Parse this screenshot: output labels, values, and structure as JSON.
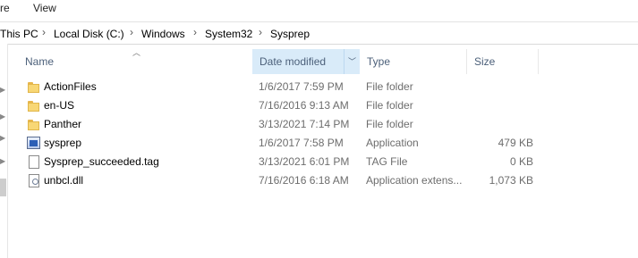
{
  "ribbon": {
    "left_fragment": "re",
    "view_label": "View"
  },
  "breadcrumb": [
    "This PC",
    "Local Disk (C:)",
    "Windows",
    "System32",
    "Sysprep"
  ],
  "columns": {
    "name": "Name",
    "date": "Date modified",
    "type": "Type",
    "size": "Size"
  },
  "icons": {
    "sort": "sort-up-caret",
    "dropdown": "chevron-down",
    "separator": "chevron-right"
  },
  "files": [
    {
      "name": "ActionFiles",
      "date": "1/6/2017 7:59 PM",
      "type": "File folder",
      "size": "",
      "icon": "folder-icon"
    },
    {
      "name": "en-US",
      "date": "7/16/2016 9:13 AM",
      "type": "File folder",
      "size": "",
      "icon": "folder-icon"
    },
    {
      "name": "Panther",
      "date": "3/13/2021 7:14 PM",
      "type": "File folder",
      "size": "",
      "icon": "folder-icon"
    },
    {
      "name": "sysprep",
      "date": "1/6/2017 7:58 PM",
      "type": "Application",
      "size": "479 KB",
      "icon": "application-icon"
    },
    {
      "name": "Sysprep_succeeded.tag",
      "date": "3/13/2021 6:01 PM",
      "type": "TAG File",
      "size": "0 KB",
      "icon": "document-icon"
    },
    {
      "name": "unbcl.dll",
      "date": "7/16/2016 6:18 AM",
      "type": "Application extens...",
      "size": "1,073 KB",
      "icon": "dll-icon"
    }
  ]
}
